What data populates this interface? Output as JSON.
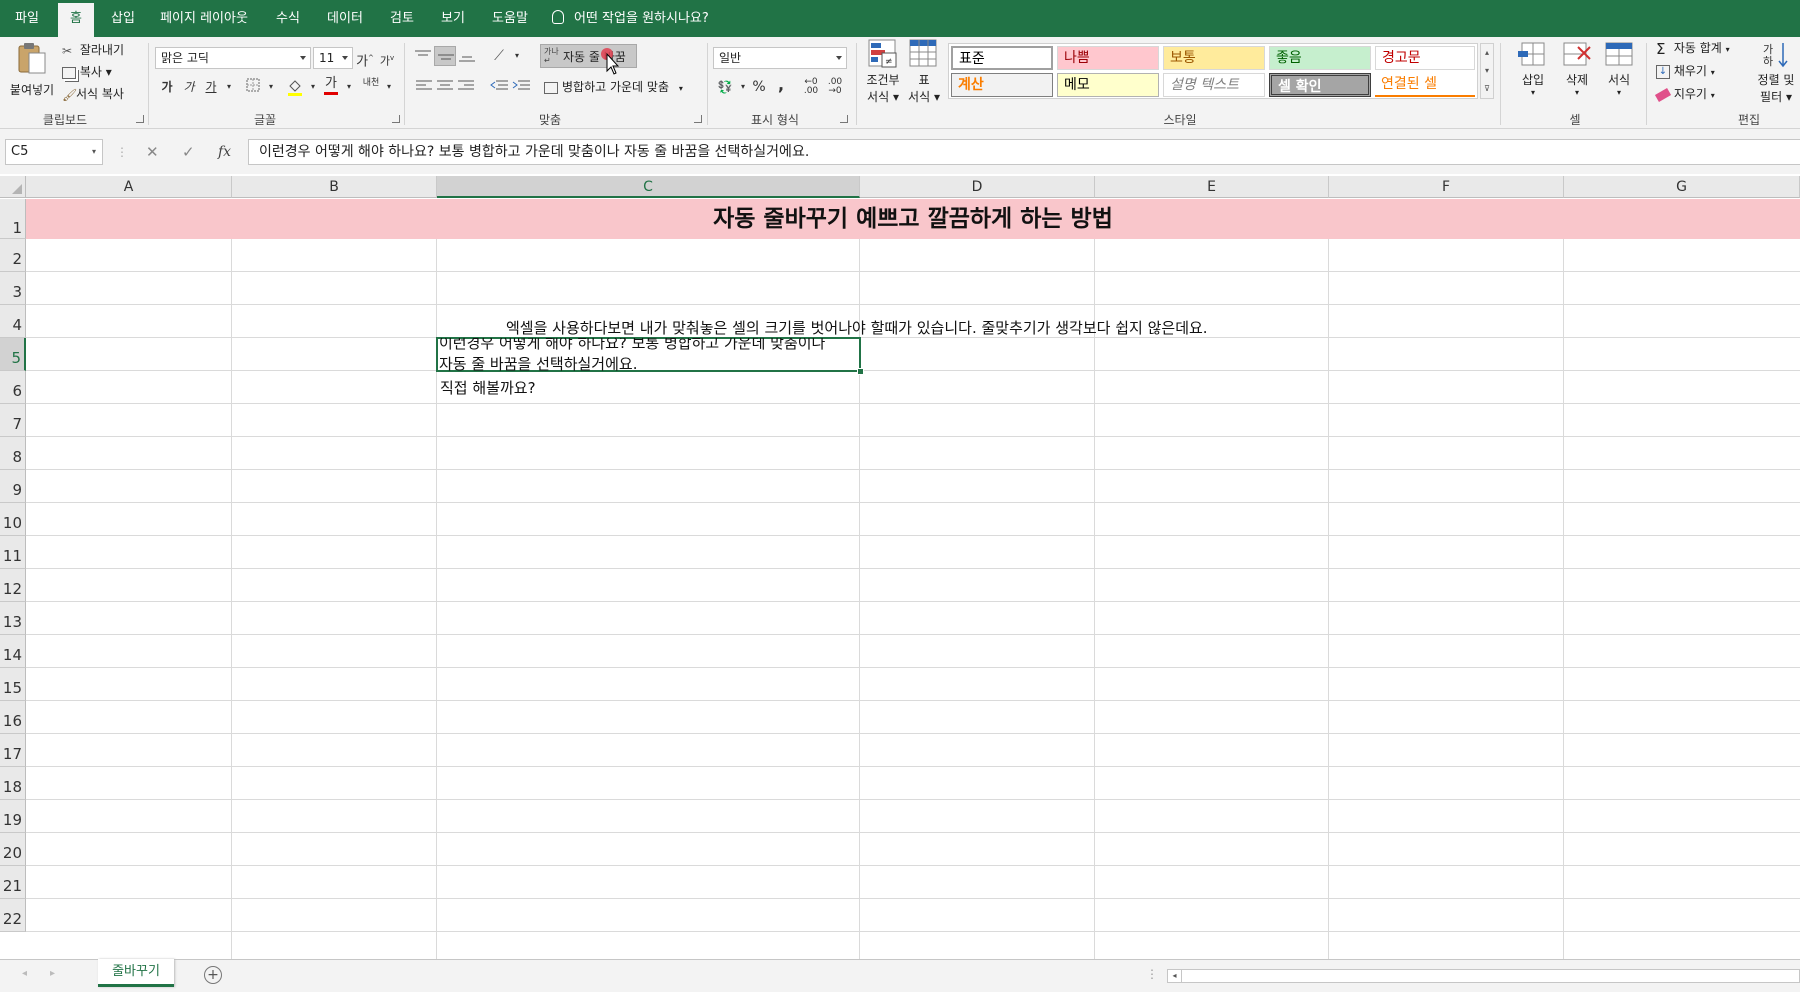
{
  "tabs": [
    "파일",
    "홈",
    "삽입",
    "페이지 레이아웃",
    "수식",
    "데이터",
    "검토",
    "보기",
    "도움말"
  ],
  "tell_me": "어떤 작업을 원하시나요?",
  "ribbon": {
    "clipboard": {
      "paste": "붙여넣기",
      "cut": "잘라내기",
      "copy": "복사",
      "format_painter": "서식 복사",
      "label": "클립보드"
    },
    "font": {
      "name": "맑은 고딕",
      "size": "11",
      "grow": "가",
      "shrink": "가",
      "bold": "가",
      "italic": "가",
      "underline": "가",
      "font_color_glyph": "가",
      "phonetic": "내천",
      "label": "글꼴"
    },
    "alignment": {
      "wrap_text": "자동 줄 바꿈",
      "merge_center": "병합하고 가운데 맞춤",
      "label": "맞춤"
    },
    "number": {
      "format": "일반",
      "percent": "%",
      "comma": ",",
      "label": "표시 형식"
    },
    "styles": {
      "conditional": "조건부",
      "conditional_sub": "서식",
      "table": "표",
      "table_sub": "서식",
      "cells": [
        {
          "text": "표준",
          "bg": "#ffffff",
          "color": "#000000",
          "italic": false
        },
        {
          "text": "나쁨",
          "bg": "#ffc7ce",
          "color": "#9c0006",
          "italic": false
        },
        {
          "text": "보통",
          "bg": "#ffeb9c",
          "color": "#9c5700",
          "italic": false
        },
        {
          "text": "좋음",
          "bg": "#c6efce",
          "color": "#006100",
          "italic": false
        },
        {
          "text": "경고문",
          "bg": "#ffffff",
          "color": "#c00000",
          "italic": false
        },
        {
          "text": "계산",
          "bg": "#f2f2f2",
          "color": "#fa7d00",
          "italic": false
        },
        {
          "text": "메모",
          "bg": "#ffffcc",
          "color": "#000000",
          "italic": false
        },
        {
          "text": "설명 텍스트",
          "bg": "#ffffff",
          "color": "#7f7f7f",
          "italic": true
        },
        {
          "text": "셀 확인",
          "bg": "#a5a5a5",
          "color": "#ffffff",
          "italic": false
        },
        {
          "text": "연결된 셀",
          "bg": "#ffffff",
          "color": "#fa7d00",
          "italic": false
        }
      ],
      "label": "스타일"
    },
    "cells": {
      "insert": "삽입",
      "delete": "삭제",
      "format": "서식",
      "label": "셀"
    },
    "editing": {
      "autosum": "자동 합계",
      "fill": "채우기",
      "clear": "지우기",
      "sort_filter": "정렬 및",
      "sort_filter_sub": "필터",
      "label": "편집"
    }
  },
  "formula_bar": {
    "name_box": "C5",
    "fx": "fx",
    "content": "이런경우 어떻게 해야 하나요? 보통 병합하고 가운데 맞춤이나 자동 줄 바꿈을 선택하실거에요."
  },
  "grid": {
    "columns": [
      "A",
      "B",
      "C",
      "D",
      "E",
      "F",
      "G"
    ],
    "rows": [
      "1",
      "2",
      "3",
      "4",
      "5",
      "6",
      "7",
      "8",
      "9",
      "10",
      "11",
      "12",
      "13",
      "14",
      "15",
      "16",
      "17",
      "18",
      "19",
      "20",
      "21",
      "22"
    ],
    "title_fill": "#f9c6cb",
    "title": "자동 줄바꾸기 예쁘고 깔끔하게 하는 방법",
    "row4": "엑셀을 사용하다보면 내가 맞춰놓은 셀의 크기를 벗어나야 할때가 있습니다. 줄맞추기가 생각보다 쉽지 않은데요.",
    "row5_line1": "이런경우 어떻게 해야 하나요? 보통 병합하고 가운데 맞춤이나",
    "row5_line2": "자동 줄 바꿈을 선택하실거에요.",
    "row6": "직접 해볼까요?"
  },
  "sheet": {
    "tab": "줄바꾸기",
    "add": "+"
  },
  "accent": "#217346"
}
